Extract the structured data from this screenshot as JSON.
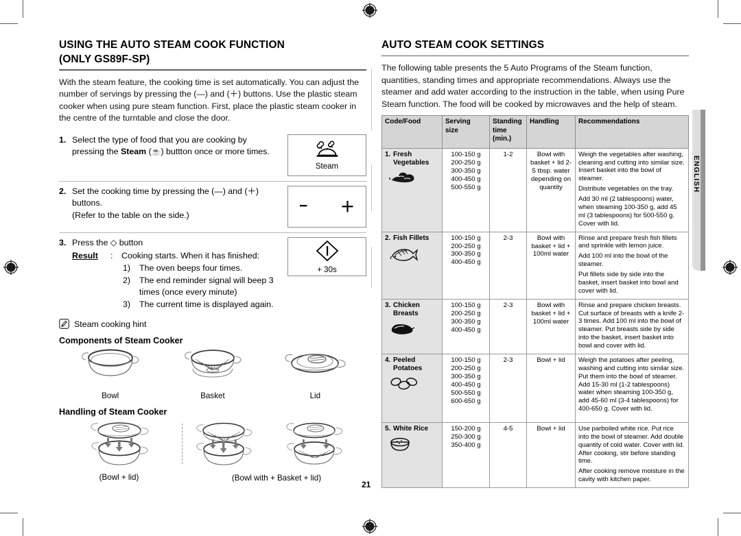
{
  "document": {
    "page_number": "21",
    "side_tab_label": "ENGLISH"
  },
  "left": {
    "title_line1": "USING THE AUTO STEAM COOK FUNCTION",
    "title_line2": "(ONLY GS89F-SP)",
    "intro": "With the steam feature, the cooking time is set automatically. You can adjust the number of servings by pressing the (—) and (＋) buttons. Use the plastic steam cooker when using pure steam function. First, place the plastic steam cooker in the centre of the turntable and close the door.",
    "steps": [
      {
        "num": "1.",
        "text_a": "Select the type of food that you are cooking by pressing the ",
        "bold": "Steam",
        "text_b": " (☕) buttton once or more times.",
        "button_label": "Steam",
        "button_icon": "steam-dome-icon"
      },
      {
        "num": "2.",
        "text_a": "Set the cooking time by pressing the (—) and (＋) buttons.",
        "text_b": "(Refer to the table on the side.)",
        "button_icon": "minus-plus-icon",
        "minus": "−",
        "plus": "＋"
      },
      {
        "num": "3.",
        "text_a": "Press the ◇ button",
        "result_label": "Result",
        "result_colon": ":",
        "result_value": "Cooking starts. When it has finished:",
        "result_items": [
          {
            "n": "1)",
            "t": "The oven beeps four times."
          },
          {
            "n": "2)",
            "t": "The end reminder signal will beep 3 times (once every minute)"
          },
          {
            "n": "3)",
            "t": "The current time is displayed again."
          }
        ],
        "button_label": "+ 30s",
        "button_icon": "start-diamond-icon"
      }
    ],
    "hint_label": "Steam cooking hint",
    "hint_icon": "note-pencil-icon",
    "components_heading": "Components of Steam Cooker",
    "components": [
      {
        "caption": "Bowl",
        "icon": "bowl-icon"
      },
      {
        "caption": "Basket",
        "icon": "basket-icon"
      },
      {
        "caption": "Lid",
        "icon": "lid-icon"
      }
    ],
    "handling_heading": "Handling of Steam Cooker",
    "handling": [
      {
        "caption": "(Bowl + lid)",
        "icon": "bowl-lid-stack-icon"
      },
      {
        "caption": "(Bowl with + Basket + lid)",
        "icon": "bowl-basket-lid-stack-icon"
      }
    ]
  },
  "right": {
    "title": "AUTO STEAM COOK SETTINGS",
    "intro": "The following table presents the 5 Auto Programs of the Steam function, quantities, standing times and appropriate recommendations. Always use the steamer and add water according to the instruction in the table, when using Pure Steam function. The food will be cooked by microwaves and the help of steam.",
    "table": {
      "headers": [
        "Code/Food",
        "Serving size",
        "Standing time (min.)",
        "Handling",
        "Recommendations"
      ],
      "rows": [
        {
          "index": "1.",
          "food": "Fresh Vegetables",
          "icon": "vegetables-icon",
          "serving_sizes": [
            "100-150 g",
            "200-250 g",
            "300-350 g",
            "400-450 g",
            "500-550 g"
          ],
          "standing_time": "1-2",
          "handling": "Bowl with basket + lid 2-5 tbsp. water depending on quantity",
          "recommendations": [
            "Weigh the vegetables after washing, cleaning and cutting into similar size. Insert basket into the bowl of steamer.",
            "Distribute vegetables on the tray.",
            "Add 30 ml (2 tablespoons) water, when steaming 100-350 g, add 45 ml (3 tablespoons) for 500-550 g. Cover with lid."
          ]
        },
        {
          "index": "2.",
          "food": "Fish Fillets",
          "icon": "fish-icon",
          "serving_sizes": [
            "100-150 g",
            "200-250 g",
            "300-350 g",
            "400-450 g"
          ],
          "standing_time": "2-3",
          "handling": "Bowl with basket + lid + 100ml water",
          "recommendations": [
            "Rinse and prepare fresh fish fillets and sprinkle with lemon juice.",
            "Add 100 ml into the bowl of the steamer.",
            "Put fillets side by side into the basket, insert basket into bowl and cover with lid."
          ]
        },
        {
          "index": "3.",
          "food": "Chicken Breasts",
          "icon": "chicken-icon",
          "serving_sizes": [
            "100-150 g",
            "200-250 g",
            "300-350 g",
            "400-450 g"
          ],
          "standing_time": "2-3",
          "handling": "Bowl with basket + lid + 100ml water",
          "recommendations": [
            "Rinse and prepare chicken breasts. Cut surface of breasts with a knife 2-3 times. Add 100 ml into the bowl of steamer. Put breasts side by side into the basket, insert basket into bowl and cover with lid."
          ]
        },
        {
          "index": "4.",
          "food": "Peeled Potatoes",
          "icon": "potatoes-icon",
          "serving_sizes": [
            "100-150 g",
            "200-250 g",
            "300-350 g",
            "400-450 g",
            "500-550 g",
            "600-650 g"
          ],
          "standing_time": "2-3",
          "handling": "Bowl + lid",
          "recommendations": [
            "Weigh the potatoes after peeling, washing and cutting into similar size. Put them into the bowl of steamer. Add 15-30 ml (1-2 tablespoons) water when steaming 100-350 g, add 45-60 ml (3-4 tablespoons) for 400-650 g. Cover with lid."
          ]
        },
        {
          "index": "5.",
          "food": "White Rice",
          "icon": "rice-bowl-icon",
          "serving_sizes": [
            "150-200 g",
            "250-300 g",
            "350-400 g"
          ],
          "standing_time": "4-5",
          "handling": "Bowl + lid",
          "recommendations": [
            "Use parboiled white rice. Put rice into the bowl of steamer. Add double quantity of cold water. Cover with lid. After cooking, stir before standing time.",
            "After cooking remove moisture in the cavity with kitchen paper."
          ]
        }
      ]
    }
  },
  "colors": {
    "header_fill": "#d5d5d5",
    "food_col_fill": "#e3e3e3",
    "rule": "#5d5d5d",
    "tab_gray": "#9a9a9a"
  }
}
